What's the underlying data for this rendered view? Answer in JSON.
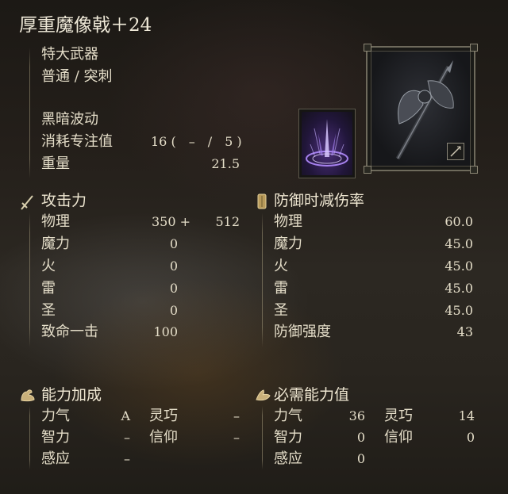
{
  "weapon": {
    "name": "厚重魔像戟＋24",
    "class": "特大武器",
    "attack_type": "普通 / 突刺",
    "skill": "黑暗波动",
    "fp_cost_label": "消耗专注值",
    "fp_cost_value": "16 (　–　/　5 )",
    "weight_label": "重量",
    "weight_value": "21.5"
  },
  "attack": {
    "header": "攻击力",
    "icon": "sword-icon",
    "rows": [
      {
        "label": "物理",
        "base": "350 +",
        "bonus": "512"
      },
      {
        "label": "魔力",
        "base": "0"
      },
      {
        "label": "火",
        "base": "0"
      },
      {
        "label": "雷",
        "base": "0"
      },
      {
        "label": "圣",
        "base": "0"
      },
      {
        "label": "致命一击",
        "base": "100"
      }
    ]
  },
  "defense": {
    "header": "防御时减伤率",
    "icon": "shield-icon",
    "rows": [
      {
        "label": "物理",
        "value": "60.0"
      },
      {
        "label": "魔力",
        "value": "45.0"
      },
      {
        "label": "火",
        "value": "45.0"
      },
      {
        "label": "雷",
        "value": "45.0"
      },
      {
        "label": "圣",
        "value": "45.0"
      },
      {
        "label": "防御强度",
        "value": "43"
      }
    ]
  },
  "scaling": {
    "header": "能力加成",
    "icon": "flexed-arm-icon",
    "rows": [
      {
        "label": "力气",
        "value": "A",
        "label2": "灵巧",
        "value2": "–"
      },
      {
        "label": "智力",
        "value": "–",
        "label2": "信仰",
        "value2": "–"
      },
      {
        "label": "感应",
        "value": "–"
      }
    ]
  },
  "requirements": {
    "header": "必需能力值",
    "icon": "hand-icon",
    "rows": [
      {
        "label": "力气",
        "value": "36",
        "label2": "灵巧",
        "value2": "14"
      },
      {
        "label": "智力",
        "value": "0",
        "label2": "信仰",
        "value2": "0"
      },
      {
        "label": "感应",
        "value": "0"
      }
    ]
  },
  "images": {
    "weapon_image": "halberd-weapon-icon",
    "skill_image": "dark-wave-skill-icon",
    "badge_icon": "weapon-type-badge-icon"
  },
  "colors": {
    "text": "#e4ddc8",
    "frame": "#6e6a5c",
    "skill_glow": "#8a5cff"
  }
}
